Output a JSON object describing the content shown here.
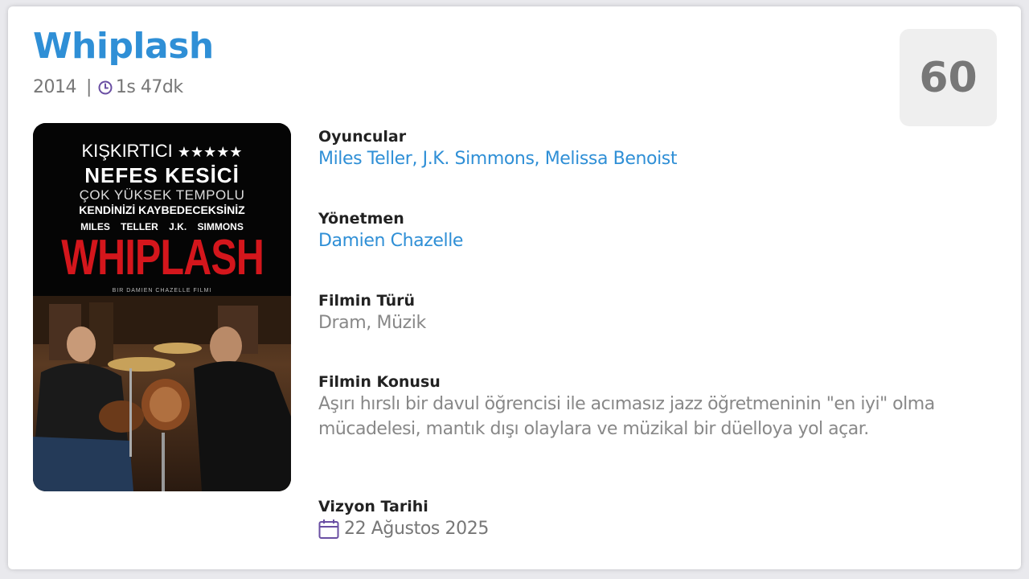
{
  "movie": {
    "title": "Whiplash",
    "year": "2014",
    "separator": "|",
    "duration": "1s 47dk",
    "score": "60"
  },
  "poster": {
    "line1": "KIŞKIRTICI",
    "stars": "★★★★★",
    "line2": "NEFES KESİCİ",
    "line3": "ÇOK YÜKSEK TEMPOLU",
    "line4": "KENDİNİZİ KAYBEDECEKSİNİZ",
    "actors": "MILES TELLER  J.K. SIMMONS",
    "title": "WHIPLASH",
    "tagline": "BIR DAMIEN CHAZELLE FILMI"
  },
  "details": {
    "cast_label": "Oyuncular",
    "cast": [
      {
        "name": "Miles Teller",
        "sep": ", "
      },
      {
        "name": "J.K. Simmons",
        "sep": ", "
      },
      {
        "name": "Melissa Benoist",
        "sep": ""
      }
    ],
    "director_label": "Yönetmen",
    "director": "Damien Chazelle",
    "genre_label": "Filmin Türü",
    "genre": "Dram, Müzik",
    "plot_label": "Filmin Konusu",
    "plot": "Aşırı hırslı bir davul öğrencisi ile acımasız jazz öğretmeninin \"en iyi\" olma mücadelesi, mantık dışı olaylara ve müzikal bir düelloya yol açar.",
    "release_label": "Vizyon Tarihi",
    "release_date": "22 Ağustos 2025"
  },
  "colors": {
    "accent": "#2f8fd6",
    "icon": "#6a4fa3",
    "muted": "#888888",
    "poster_title": "#d4161c"
  }
}
